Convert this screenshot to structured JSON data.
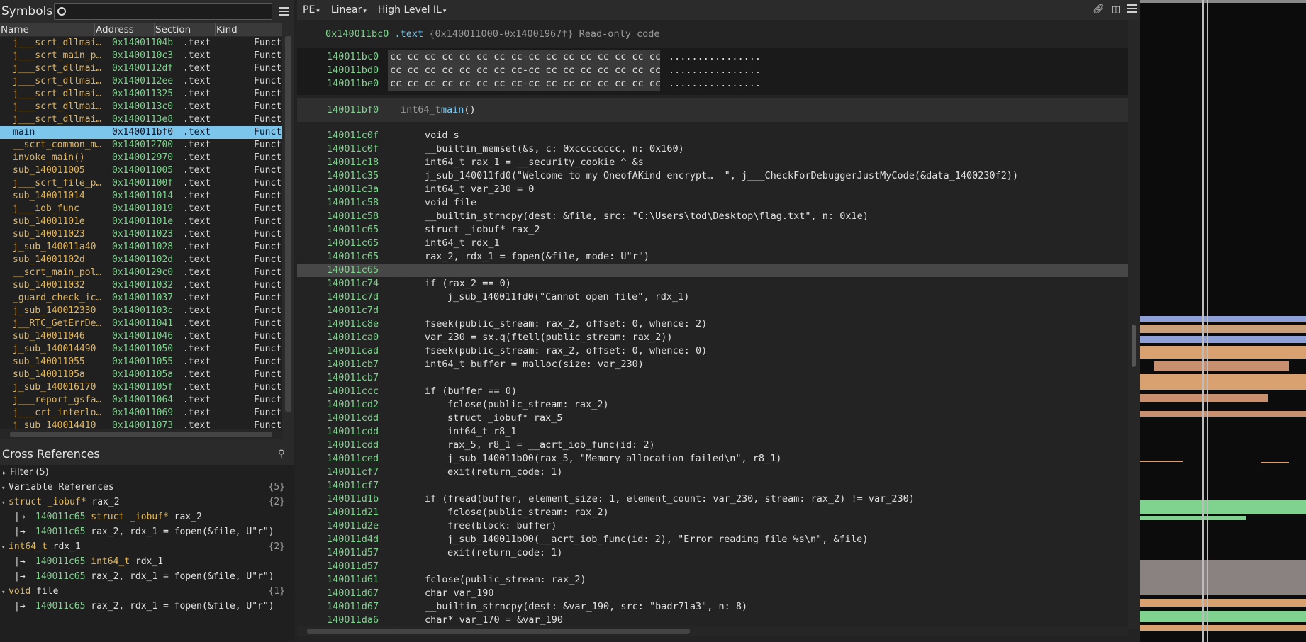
{
  "symbols": {
    "title": "Symbols",
    "search_value": "",
    "columns": [
      "Name",
      "Address",
      "Section",
      "Kind"
    ],
    "rows": [
      {
        "name": "j___scrt_dllmai…",
        "address": "0x14001104b",
        "section": ".text",
        "kind": "Funct"
      },
      {
        "name": "j___scrt_main_p…",
        "address": "0x1400110c3",
        "section": ".text",
        "kind": "Funct"
      },
      {
        "name": "j___scrt_dllmai…",
        "address": "0x1400112df",
        "section": ".text",
        "kind": "Funct"
      },
      {
        "name": "j___scrt_dllmai…",
        "address": "0x1400112ee",
        "section": ".text",
        "kind": "Funct"
      },
      {
        "name": "j___scrt_dllmai…",
        "address": "0x140011325",
        "section": ".text",
        "kind": "Funct"
      },
      {
        "name": "j___scrt_dllmai…",
        "address": "0x1400113c0",
        "section": ".text",
        "kind": "Funct"
      },
      {
        "name": "j___scrt_dllmai…",
        "address": "0x1400113e8",
        "section": ".text",
        "kind": "Funct"
      },
      {
        "name": "main",
        "address": "0x140011bf0",
        "section": ".text",
        "kind": "Funct",
        "selected": true
      },
      {
        "name": "__scrt_common_m…",
        "address": "0x140012700",
        "section": ".text",
        "kind": "Funct"
      },
      {
        "name": "invoke_main()",
        "address": "0x140012970",
        "section": ".text",
        "kind": "Funct"
      },
      {
        "name": "sub_140011005",
        "address": "0x140011005",
        "section": ".text",
        "kind": "Funct"
      },
      {
        "name": "j___scrt_file_p…",
        "address": "0x14001100f",
        "section": ".text",
        "kind": "Funct"
      },
      {
        "name": "sub_140011014",
        "address": "0x140011014",
        "section": ".text",
        "kind": "Funct"
      },
      {
        "name": "j___iob_func",
        "address": "0x140011019",
        "section": ".text",
        "kind": "Funct"
      },
      {
        "name": "sub_14001101e",
        "address": "0x14001101e",
        "section": ".text",
        "kind": "Funct"
      },
      {
        "name": "sub_140011023",
        "address": "0x140011023",
        "section": ".text",
        "kind": "Funct"
      },
      {
        "name": "j_sub_140011a40",
        "address": "0x140011028",
        "section": ".text",
        "kind": "Funct"
      },
      {
        "name": "sub_14001102d",
        "address": "0x14001102d",
        "section": ".text",
        "kind": "Funct"
      },
      {
        "name": "__scrt_main_pol…",
        "address": "0x1400129c0",
        "section": ".text",
        "kind": "Funct"
      },
      {
        "name": "sub_140011032",
        "address": "0x140011032",
        "section": ".text",
        "kind": "Funct"
      },
      {
        "name": "_guard_check_ic…",
        "address": "0x140011037",
        "section": ".text",
        "kind": "Funct"
      },
      {
        "name": "j_sub_140012330",
        "address": "0x14001103c",
        "section": ".text",
        "kind": "Funct"
      },
      {
        "name": "j__RTC_GetErrDe…",
        "address": "0x140011041",
        "section": ".text",
        "kind": "Funct"
      },
      {
        "name": "sub_140011046",
        "address": "0x140011046",
        "section": ".text",
        "kind": "Funct"
      },
      {
        "name": "j_sub_140014490",
        "address": "0x140011050",
        "section": ".text",
        "kind": "Funct"
      },
      {
        "name": "sub_140011055",
        "address": "0x140011055",
        "section": ".text",
        "kind": "Funct"
      },
      {
        "name": "sub_14001105a",
        "address": "0x14001105a",
        "section": ".text",
        "kind": "Funct"
      },
      {
        "name": "j_sub_140016170",
        "address": "0x14001105f",
        "section": ".text",
        "kind": "Funct"
      },
      {
        "name": "j___report_gsfa…",
        "address": "0x140011064",
        "section": ".text",
        "kind": "Funct"
      },
      {
        "name": "j___crt_interlo…",
        "address": "0x140011069",
        "section": ".text",
        "kind": "Funct"
      },
      {
        "name": "j_sub_140014410",
        "address": "0x140011073",
        "section": ".text",
        "kind": "Funct"
      }
    ]
  },
  "xrefs": {
    "title": "Cross References",
    "filter": "Filter (5)",
    "group": "Variable References",
    "group_count": "{5}",
    "vars": [
      {
        "decl_type": "struct _iobuf*",
        "decl_name": " rax_2",
        "count": "{2}",
        "refs": [
          {
            "addr": "140011c65",
            "kw": "struct _iobuf*",
            "rest": " rax_2"
          },
          {
            "addr": "140011c65",
            "kw": "",
            "rest": "rax_2, rdx_1 = fopen(&file, U\"r\")"
          }
        ]
      },
      {
        "decl_type": "int64_t",
        "decl_name": " rdx_1",
        "count": "{2}",
        "refs": [
          {
            "addr": "140011c65",
            "kw": "int64_t",
            "rest": " rdx_1"
          },
          {
            "addr": "140011c65",
            "kw": "",
            "rest": "rax_2, rdx_1 = fopen(&file, U\"r\")"
          }
        ]
      },
      {
        "decl_type": "void",
        "decl_name": " file",
        "count": "{1}",
        "refs": [
          {
            "addr": "140011c65",
            "kw": "",
            "rest": "rax_2, rdx_1 = fopen(&file, U\"r\")"
          }
        ]
      }
    ]
  },
  "toolbar": {
    "pe": "PE",
    "view": "Linear",
    "il": "High Level IL"
  },
  "main": {
    "header_addr": "0x140011bc0",
    "header_section": ".text",
    "header_range": "{0x140011000-0x14001967f}",
    "header_desc": "Read-only code",
    "hex": [
      {
        "addr": "140011bc0",
        "bytes": "cc cc cc cc cc cc cc cc-cc cc cc cc cc cc cc cc",
        "ascii": "................"
      },
      {
        "addr": "140011bd0",
        "bytes": "cc cc cc cc cc cc cc cc-cc cc cc cc cc cc cc cc",
        "ascii": "................"
      },
      {
        "addr": "140011be0",
        "bytes": "cc cc cc cc cc cc cc cc-cc cc cc cc cc cc cc cc",
        "ascii": "................"
      }
    ],
    "func_addr": "140011bf0",
    "func_type": "int64_t ",
    "func_name": "main",
    "func_tail": "()",
    "code": [
      {
        "addr": "140011c0f",
        "indent": 0,
        "text": "void s"
      },
      {
        "addr": "140011c0f",
        "indent": 0,
        "text": "__builtin_memset(&s, c: 0xcccccccc, n: 0x160)"
      },
      {
        "addr": "140011c18",
        "indent": 0,
        "text": "int64_t rax_1 = __security_cookie ^ &s"
      },
      {
        "addr": "140011c35",
        "indent": 0,
        "text": "j_sub_140011fd0(\"Welcome to my OneofAKind encrypt…  \", j___CheckForDebuggerJustMyCode(&data_1400230f2))"
      },
      {
        "addr": "140011c3a",
        "indent": 0,
        "text": "int64_t var_230 = 0"
      },
      {
        "addr": "140011c58",
        "indent": 0,
        "text": "void file"
      },
      {
        "addr": "140011c58",
        "indent": 0,
        "text": "__builtin_strncpy(dest: &file, src: \"C:\\Users\\tod\\Desktop\\flag.txt\", n: 0x1e)"
      },
      {
        "addr": "140011c65",
        "indent": 0,
        "text": "struct _iobuf* rax_2"
      },
      {
        "addr": "140011c65",
        "indent": 0,
        "text": "int64_t rdx_1"
      },
      {
        "addr": "140011c65",
        "indent": 0,
        "text": "rax_2, rdx_1 = fopen(&file, mode: U\"r\")"
      },
      {
        "addr": "140011c65",
        "indent": 0,
        "text": "",
        "highlight": true
      },
      {
        "addr": "140011c74",
        "indent": 0,
        "text": "if (rax_2 == 0)"
      },
      {
        "addr": "140011c7d",
        "indent": 1,
        "text": "j_sub_140011fd0(\"Cannot open file\", rdx_1)"
      },
      {
        "addr": "140011c7d",
        "indent": 0,
        "text": ""
      },
      {
        "addr": "140011c8e",
        "indent": 0,
        "text": "fseek(public_stream: rax_2, offset: 0, whence: 2)"
      },
      {
        "addr": "140011ca0",
        "indent": 0,
        "text": "var_230 = sx.q(ftell(public_stream: rax_2))"
      },
      {
        "addr": "140011cad",
        "indent": 0,
        "text": "fseek(public_stream: rax_2, offset: 0, whence: 0)"
      },
      {
        "addr": "140011cb7",
        "indent": 0,
        "text": "int64_t buffer = malloc(size: var_230)"
      },
      {
        "addr": "140011cb7",
        "indent": 0,
        "text": ""
      },
      {
        "addr": "140011ccc",
        "indent": 0,
        "text": "if (buffer == 0)"
      },
      {
        "addr": "140011cd2",
        "indent": 1,
        "text": "fclose(public_stream: rax_2)"
      },
      {
        "addr": "140011cdd",
        "indent": 1,
        "text": "struct _iobuf* rax_5"
      },
      {
        "addr": "140011cdd",
        "indent": 1,
        "text": "int64_t r8_1"
      },
      {
        "addr": "140011cdd",
        "indent": 1,
        "text": "rax_5, r8_1 = __acrt_iob_func(id: 2)"
      },
      {
        "addr": "140011ced",
        "indent": 1,
        "text": "j_sub_140011b00(rax_5, \"Memory allocation failed\\n\", r8_1)"
      },
      {
        "addr": "140011cf7",
        "indent": 1,
        "text": "exit(return_code: 1)"
      },
      {
        "addr": "140011cf7",
        "indent": 0,
        "text": ""
      },
      {
        "addr": "140011d1b",
        "indent": 0,
        "text": "if (fread(buffer, element_size: 1, element_count: var_230, stream: rax_2) != var_230)"
      },
      {
        "addr": "140011d21",
        "indent": 1,
        "text": "fclose(public_stream: rax_2)"
      },
      {
        "addr": "140011d2e",
        "indent": 1,
        "text": "free(block: buffer)"
      },
      {
        "addr": "140011d4d",
        "indent": 1,
        "text": "j_sub_140011b00(__acrt_iob_func(id: 2), \"Error reading file %s\\n\", &file)"
      },
      {
        "addr": "140011d57",
        "indent": 1,
        "text": "exit(return_code: 1)"
      },
      {
        "addr": "140011d57",
        "indent": 0,
        "text": ""
      },
      {
        "addr": "140011d61",
        "indent": 0,
        "text": "fclose(public_stream: rax_2)"
      },
      {
        "addr": "140011d67",
        "indent": 0,
        "text": "char var_190"
      },
      {
        "addr": "140011d67",
        "indent": 0,
        "text": "__builtin_strncpy(dest: &var_190, src: \"badr7la3\", n: 8)"
      },
      {
        "addr": "140011da6",
        "indent": 0,
        "text": "char* var_170 = &var_190"
      }
    ]
  },
  "colors": {
    "accent": "#7cc6ec",
    "address": "#7fd38f",
    "function": "#e2b85a",
    "type": "#9ccc70",
    "selection": "#7cc6ec"
  },
  "icons": [
    "search-icon",
    "menu-icon",
    "pin-icon",
    "link-icon",
    "split-icon",
    "chevron-down-icon",
    "xref-arrow-icon"
  ]
}
